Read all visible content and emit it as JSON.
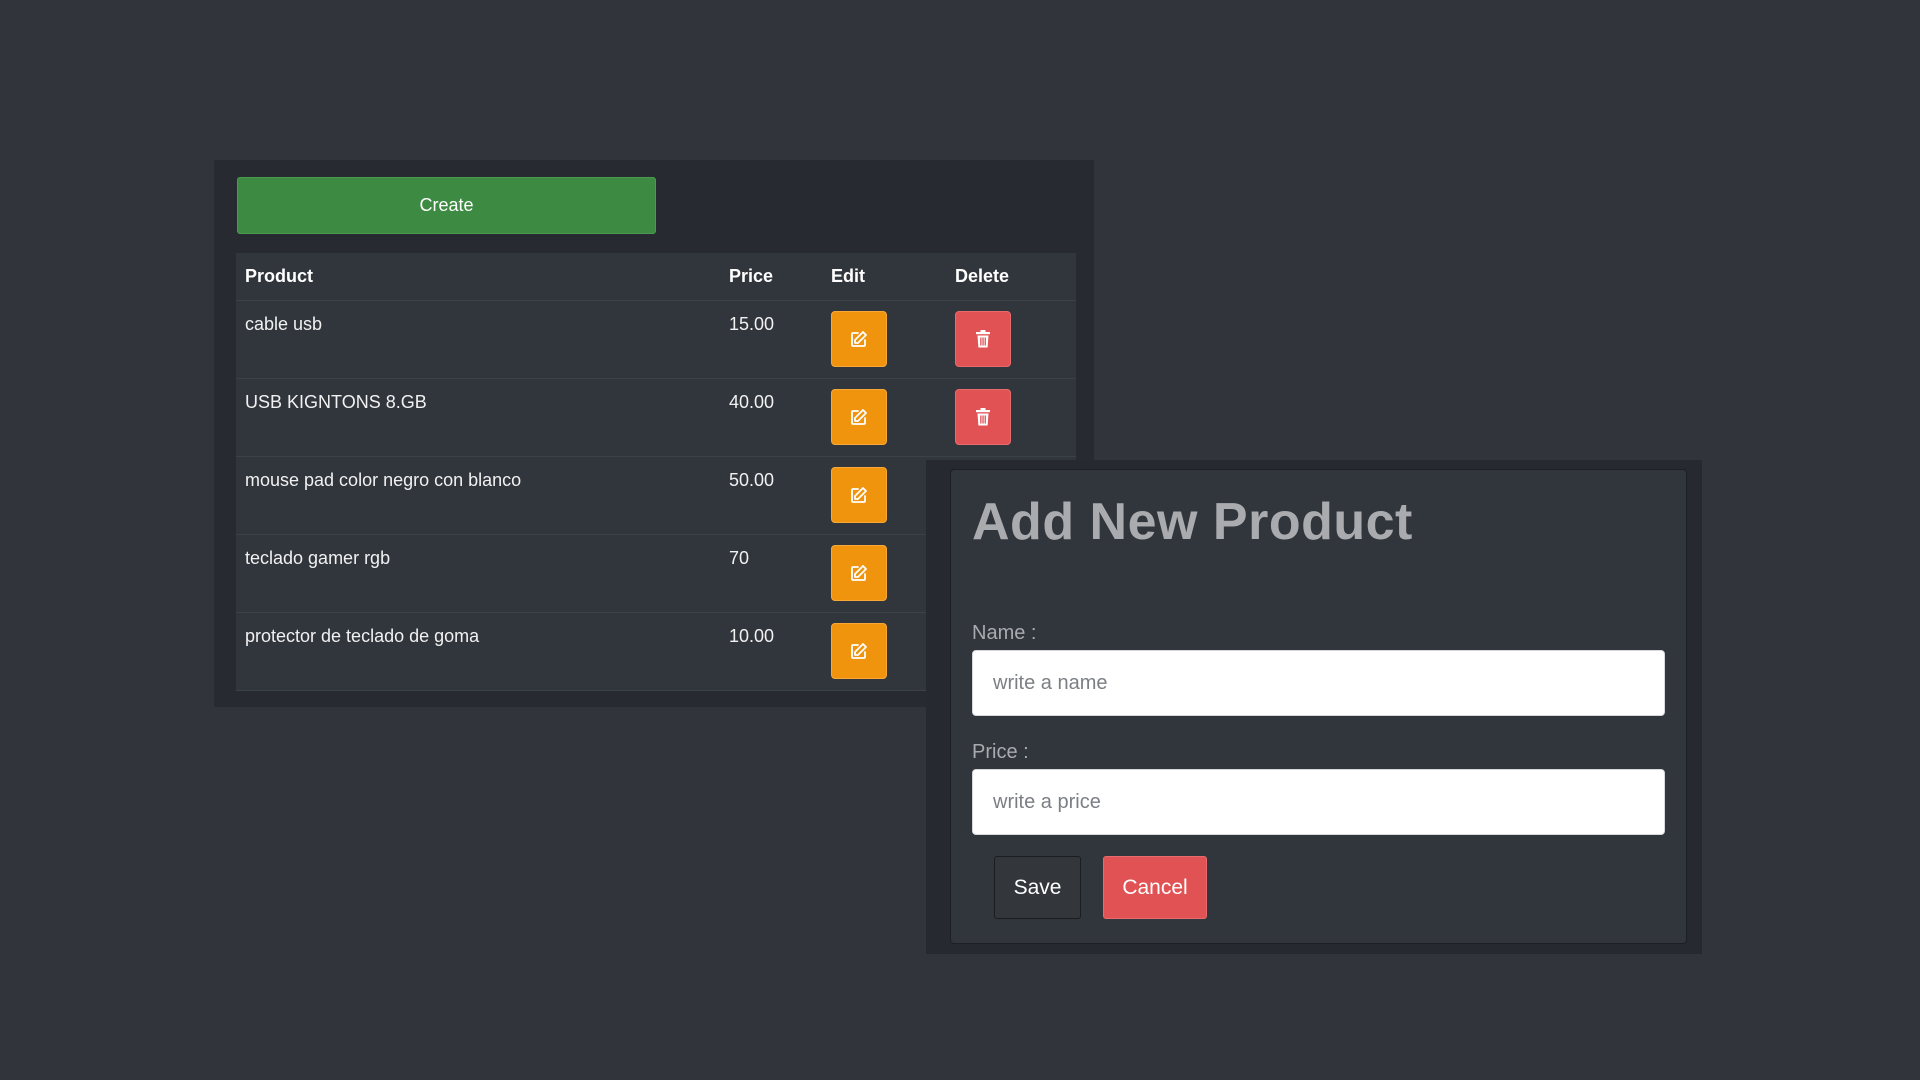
{
  "product_list": {
    "create_label": "Create",
    "columns": {
      "product": "Product",
      "price": "Price",
      "edit": "Edit",
      "delete": "Delete"
    },
    "rows": [
      {
        "name": "cable usb",
        "price": "15.00"
      },
      {
        "name": "USB KIGNTONS 8.GB",
        "price": "40.00"
      },
      {
        "name": "mouse pad color negro con blanco",
        "price": "50.00"
      },
      {
        "name": "teclado gamer rgb",
        "price": "70"
      },
      {
        "name": "protector de teclado de goma",
        "price": "10.00"
      }
    ],
    "icons": {
      "edit": "edit-icon",
      "delete": "trash-icon"
    }
  },
  "modal": {
    "title": "Add New Product",
    "name_label": "Name :",
    "name_placeholder": "write a name",
    "name_value": "",
    "price_label": "Price :",
    "price_placeholder": "write a price",
    "price_value": "",
    "save_label": "Save",
    "cancel_label": "Cancel"
  },
  "colors": {
    "background": "#31343a",
    "create_green": "#3d8a42",
    "edit_orange": "#f0940e",
    "delete_red": "#e05254",
    "save_dark": "#33363b"
  }
}
